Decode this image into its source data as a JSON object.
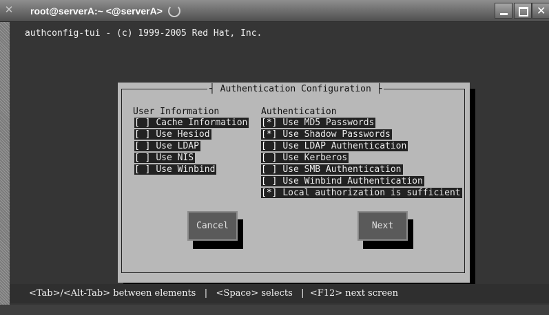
{
  "window": {
    "title": "root@serverA:~ <@serverA>",
    "icon": "terminal-icon"
  },
  "terminal": {
    "header": "authconfig-tui - (c) 1999-2005 Red Hat, Inc."
  },
  "dialog": {
    "title": "Authentication Configuration",
    "user_info": {
      "heading": "User Information",
      "options": [
        {
          "box": "[ ]",
          "label": "Cache Information"
        },
        {
          "box": "[ ]",
          "label": "Use Hesiod"
        },
        {
          "box": "[ ]",
          "label": "Use LDAP"
        },
        {
          "box": "[ ]",
          "label": "Use NIS"
        },
        {
          "box": "[ ]",
          "label": "Use Winbind"
        }
      ]
    },
    "auth": {
      "heading": "Authentication",
      "options": [
        {
          "box": "[*]",
          "label": "Use MD5 Passwords"
        },
        {
          "box": "[*]",
          "label": "Use Shadow Passwords"
        },
        {
          "box": "[ ]",
          "label": "Use LDAP Authentication"
        },
        {
          "box": "[ ]",
          "label": "Use Kerberos"
        },
        {
          "box": "[ ]",
          "label": "Use SMB Authentication"
        },
        {
          "box": "[ ]",
          "label": "Use Winbind Authentication"
        },
        {
          "box": "[*]",
          "label": "Local authorization is sufficient"
        }
      ]
    },
    "cancel_label": "Cancel",
    "next_label": "Next"
  },
  "statusbar": {
    "text": "<Tab>/<Alt-Tab> between elements   |   <Space> selects   |  <F12> next screen"
  }
}
